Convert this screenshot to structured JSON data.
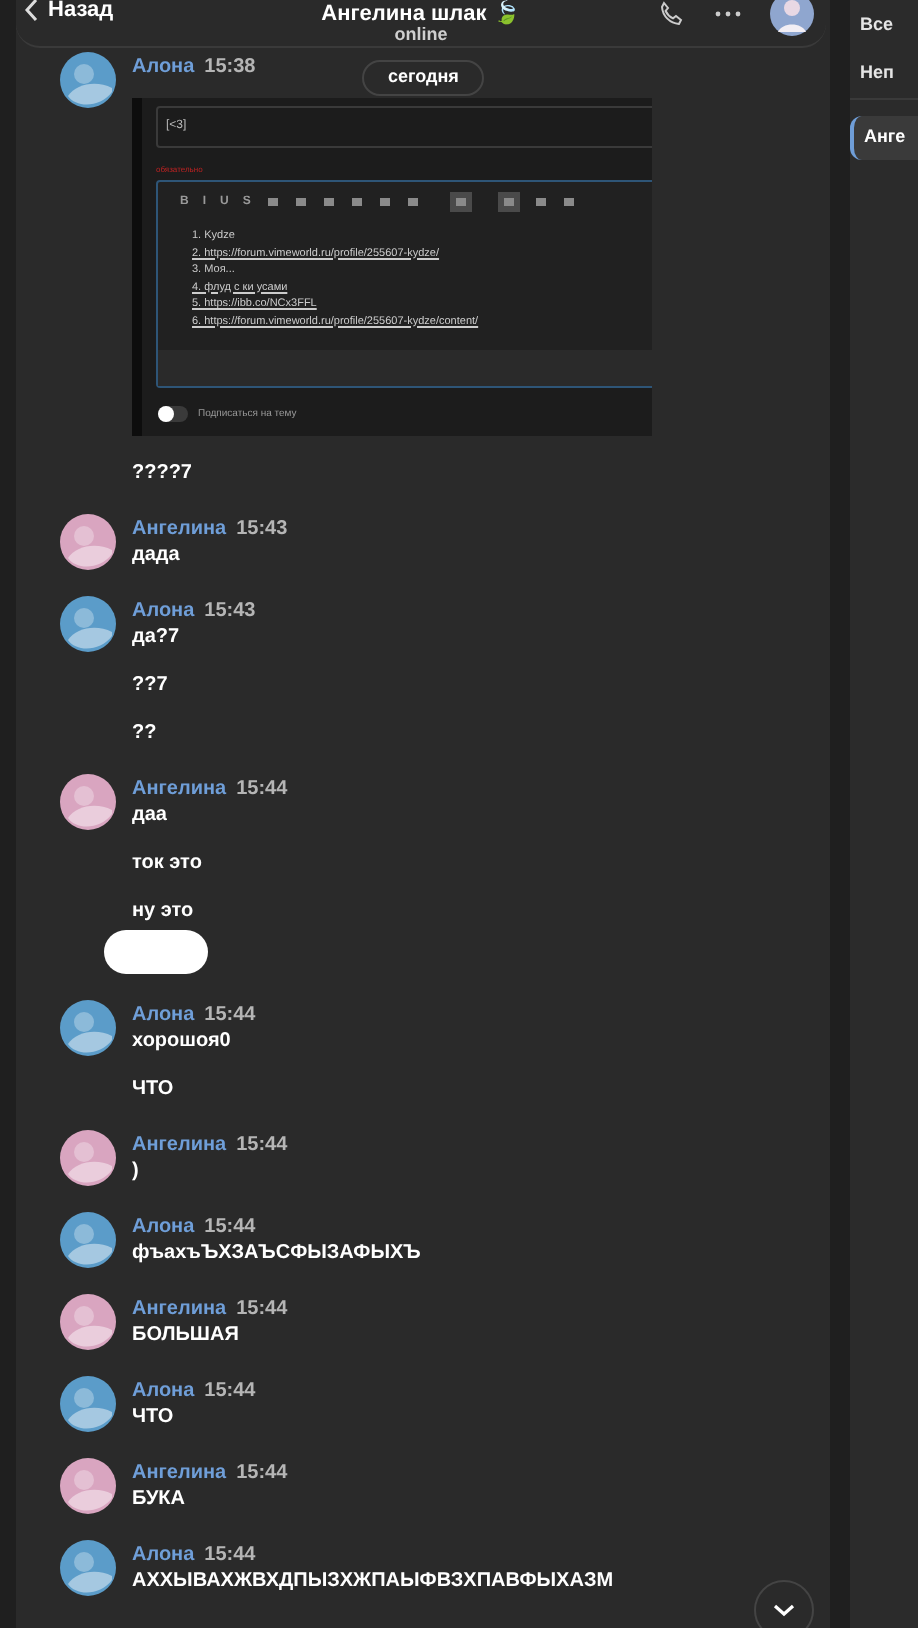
{
  "header": {
    "back": "Назад",
    "title": "Ангелина шлак 🍃",
    "status": "online"
  },
  "date_chip": "сегодня",
  "sidebar": {
    "items": [
      {
        "label": "Все",
        "selected": false
      },
      {
        "label": "Неп",
        "selected": false
      },
      {
        "label": "Анге",
        "selected": true
      }
    ]
  },
  "messages": [
    {
      "sender": "Алона",
      "time": "15:38",
      "color": "#5b9cc9",
      "lines": [
        {
          "kind": "image",
          "screenshot": {
            "title_field": "[<3]",
            "required_label": "обязательно",
            "toolbar": [
              "B",
              "I",
              "U",
              "S"
            ],
            "list": [
              "1. Kydze",
              "2. https://forum.vimeworld.ru/profile/255607-kydze/",
              "3. Моя...",
              "4. флуд с ки усами",
              "5. https://ibb.co/NCx3FFL",
              "6. https://forum.vimeworld.ru/profile/255607-kydze/content/"
            ],
            "subscribe": {
              "label": "Подписаться на тему",
              "on": false
            }
          }
        },
        {
          "kind": "text",
          "text": "????7"
        }
      ]
    },
    {
      "sender": "Ангелина",
      "time": "15:43",
      "color": "#d9a5c0",
      "lines": [
        {
          "kind": "text",
          "text": "дада"
        }
      ]
    },
    {
      "sender": "Алона",
      "time": "15:43",
      "color": "#5b9cc9",
      "lines": [
        {
          "kind": "text",
          "text": "да?7"
        },
        {
          "kind": "text",
          "text": "??7"
        },
        {
          "kind": "text",
          "text": "??"
        }
      ]
    },
    {
      "sender": "Ангелина",
      "time": "15:44",
      "color": "#d9a5c0",
      "lines": [
        {
          "kind": "text",
          "text": "даа"
        },
        {
          "kind": "text",
          "text": "ток это"
        },
        {
          "kind": "text",
          "text": "ну это"
        },
        {
          "kind": "redacted"
        }
      ]
    },
    {
      "sender": "Алона",
      "time": "15:44",
      "color": "#5b9cc9",
      "lines": [
        {
          "kind": "text",
          "text": "хорошоя0"
        },
        {
          "kind": "text",
          "text": "ЧТО"
        }
      ]
    },
    {
      "sender": "Ангелина",
      "time": "15:44",
      "color": "#d9a5c0",
      "lines": [
        {
          "kind": "text",
          "text": ")"
        }
      ]
    },
    {
      "sender": "Алона",
      "time": "15:44",
      "color": "#5b9cc9",
      "lines": [
        {
          "kind": "text",
          "text": "фъахъЪХЗАЪСФЫЗАФЫХЪ"
        }
      ]
    },
    {
      "sender": "Ангелина",
      "time": "15:44",
      "color": "#d9a5c0",
      "lines": [
        {
          "kind": "text",
          "text": "БОЛЬШАЯ"
        }
      ]
    },
    {
      "sender": "Алона",
      "time": "15:44",
      "color": "#5b9cc9",
      "lines": [
        {
          "kind": "text",
          "text": "ЧТО"
        }
      ]
    },
    {
      "sender": "Ангелина",
      "time": "15:44",
      "color": "#d9a5c0",
      "lines": [
        {
          "kind": "text",
          "text": "БУКА"
        }
      ]
    },
    {
      "sender": "Алона",
      "time": "15:44",
      "color": "#5b9cc9",
      "lines": [
        {
          "kind": "text",
          "text": "АХХЫВАХЖВХДПЫЗХЖПАЫФВЗХПАВФЫХАЗМ"
        }
      ]
    }
  ]
}
